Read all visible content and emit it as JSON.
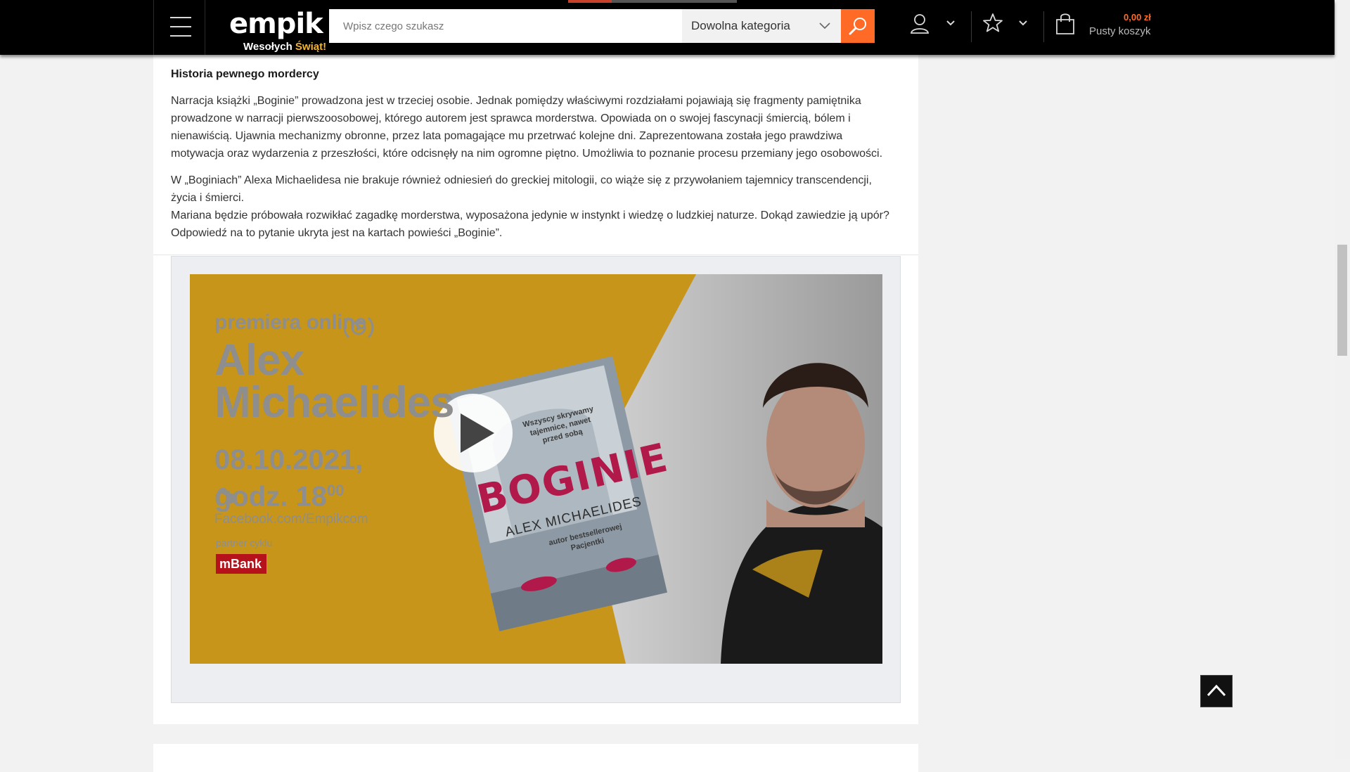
{
  "header": {
    "logo_text": "empik",
    "logo_tagline_a": "Wesołych ",
    "logo_tagline_b": "Świąt!",
    "search_placeholder": "Wpisz czego szukasz",
    "category_label": "Dowolna kategoria",
    "cart_price": "0,00 zł",
    "cart_label": "Pusty koszyk"
  },
  "article": {
    "heading": "Historia pewnego mordercy",
    "paragraph_1": "Narracja książki „Boginie” prowadzona jest w trzeciej osobie. Jednak pomiędzy właściwymi rozdziałami pojawiają się fragmenty pamiętnika prowadzone w narracji pierwszoosobowej, którego autorem jest sprawca morderstwa. Opowiada on o swojej fascynacji śmiercią, bólem i nienawiścią. Ujawnia mechanizmy obronne, przez lata pomagające mu przetrwać kolejne dni. Zaprezentowana została jego prawdziwa motywacja oraz wydarzenia z przeszłości, które odcisnęły na nim ogromne piętno. Umożliwia to poznanie procesu przemiany jego osobowości.",
    "paragraph_2a": "W „Boginiach” Alexa Michaelidesa nie brakuje również odniesień do greckiej mitologii, co wiąże się z przywołaniem tajemnicy transcendencji, życia i śmierci.",
    "paragraph_2b": "Mariana będzie próbowała rozwikłać zagadkę morderstwa, wyposażona jedynie w instynkt i wiedzę o ludzkiej naturze. Dokąd zawiedzie ją upór? Odpowiedź na to pytanie ukryta jest na kartach powieści „Boginie”."
  },
  "video": {
    "premiere": "premiera online",
    "author_line1": "Alex",
    "author_line2": "Michaelides",
    "date": "08.10.2021,",
    "time_prefix": "godz. 18",
    "time_sup": "00",
    "link": "Facebook.com/Empikcom",
    "partner_label": "partner cyklu",
    "partner_name": "mBank",
    "book_title": "BOGINIE",
    "book_author": "ALEX MICHAELIDES",
    "book_blurb": "Wszyscy skrywamy tajemnice, nawet przed sobą",
    "book_note": "autor bestsellerowej Pacjentki",
    "accent_color": "#c6951a"
  },
  "colors": {
    "brand_orange": "#ff6b27",
    "header_bg": "#000000"
  }
}
